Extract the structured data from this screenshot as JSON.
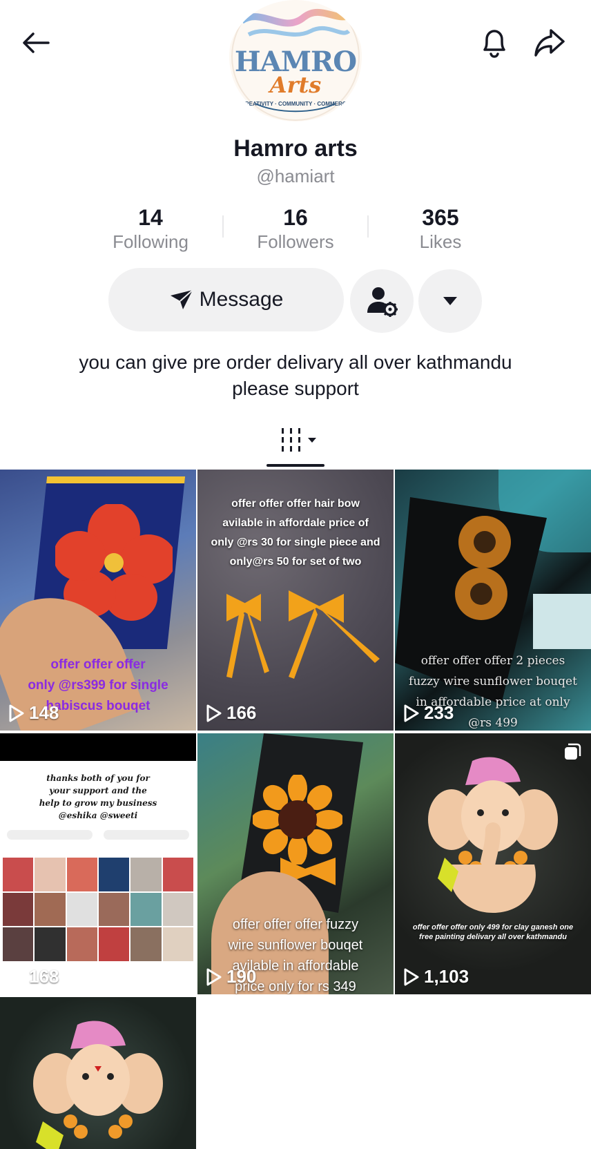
{
  "profile": {
    "name": "Hamro arts",
    "handle": "@hamiart",
    "logo_line1": "HAMRO",
    "logo_line2": "Arts",
    "logo_ring": "CREATIVITY · COMMUNITY · COMMERCE"
  },
  "stats": [
    {
      "value": "14",
      "label": "Following"
    },
    {
      "value": "16",
      "label": "Followers"
    },
    {
      "value": "365",
      "label": "Likes"
    }
  ],
  "actions": {
    "message_label": "Message"
  },
  "bio": {
    "line1": "you can give pre order delivary all over kathmandu",
    "line2": "please support"
  },
  "colors": {
    "text": "#161823",
    "muted": "#8a8b91",
    "button_bg": "#f1f1f2",
    "caption_purple": "#8a2be2"
  },
  "icons": {
    "back": "back-arrow-icon",
    "bell": "bell-icon",
    "share": "share-icon",
    "message": "paper-plane-icon",
    "user_settings": "user-gear-icon",
    "dropdown": "caret-down-icon",
    "grid_tab": "grid-tab-icon",
    "play": "play-icon",
    "multi": "multi-image-icon"
  },
  "videos": [
    {
      "views": "148",
      "caption": "offer offer offer\nonly @rs399 for single\nhabiscus bouqet"
    },
    {
      "views": "166",
      "caption": "offer offer offer hair bow\navilable in affordale price of\nonly @rs 30 for single piece and\nonly@rs 50 for set of two"
    },
    {
      "views": "233",
      "caption": "offer offer offer 2 pieces\nfuzzy wire sunflower bouqet\nin affordable price at only\n@rs 499"
    },
    {
      "views": "168",
      "caption": "thanks both of you for\nyour support and the\nhelp to grow my business\n@eshika @sweeti"
    },
    {
      "views": "190",
      "caption": "offer offer offer fuzzy\nwire sunflower bouqet\navilable in affordable\nprice only for rs 349"
    },
    {
      "views": "1,103",
      "caption": "offer offer offer only 499 for clay ganesh one\nfree painting delivary all over kathmandu"
    },
    {
      "views": "",
      "caption": ""
    }
  ]
}
